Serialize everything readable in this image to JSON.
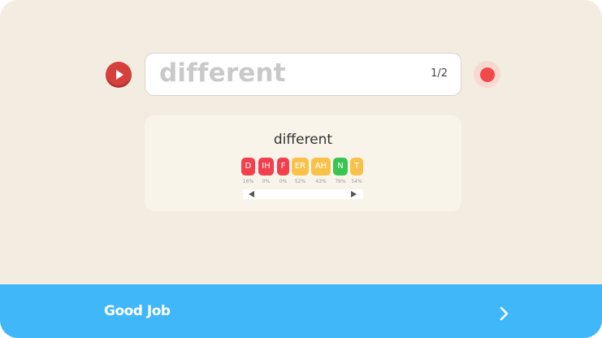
{
  "prompt": {
    "word": "different",
    "counter": "1/2"
  },
  "analysis": {
    "word": "different",
    "phonemes": [
      {
        "label": "D",
        "score": "16%",
        "color": "#f2404e"
      },
      {
        "label": "IH",
        "score": "0%",
        "color": "#f2404e"
      },
      {
        "label": "F",
        "score": "0%",
        "color": "#f2404e"
      },
      {
        "label": "ER",
        "score": "52%",
        "color": "#f8c24a"
      },
      {
        "label": "AH",
        "score": "43%",
        "color": "#f8c24a"
      },
      {
        "label": "N",
        "score": "76%",
        "color": "#38c552"
      },
      {
        "label": "T",
        "score": "54%",
        "color": "#f8c24a"
      }
    ]
  },
  "footer": {
    "message": "Good Job"
  },
  "icons": {
    "play": "play-icon",
    "record": "record-icon",
    "next": "chevron-right-icon",
    "scroll_left": "caret-left-icon",
    "scroll_right": "caret-right-icon"
  },
  "colors": {
    "background": "#f3ece0",
    "accent": "#3fb7f8",
    "play": "#d6403c",
    "record": "#f0494b",
    "bad": "#f2404e",
    "medium": "#f8c24a",
    "good": "#38c552"
  }
}
